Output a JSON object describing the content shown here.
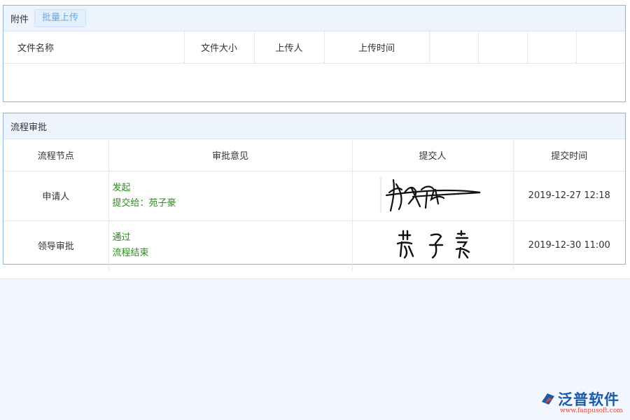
{
  "attachments": {
    "title": "附件",
    "upload_label": "批量上传",
    "columns": [
      "文件名称",
      "文件大小",
      "上传人",
      "上传时间",
      "",
      "",
      "",
      ""
    ],
    "rows": []
  },
  "workflow": {
    "title": "流程审批",
    "columns": [
      "流程节点",
      "审批意见",
      "提交人",
      "提交时间"
    ],
    "rows": [
      {
        "node": "申请人",
        "opinion_line1": "发起",
        "opinion_line2": "提交给：苑子豪",
        "time": "2019-12-27 12:18"
      },
      {
        "node": "领导审批",
        "opinion_line1": "通过",
        "opinion_line2": "流程结束",
        "time": "2019-12-30 11:00"
      }
    ]
  },
  "brand": {
    "name": "泛普软件",
    "url": "www.fanpusoft.com",
    "colors": {
      "primary": "#1b5aa6",
      "accent": "#d34d3a",
      "approved_text": "#2f8a1f"
    }
  }
}
